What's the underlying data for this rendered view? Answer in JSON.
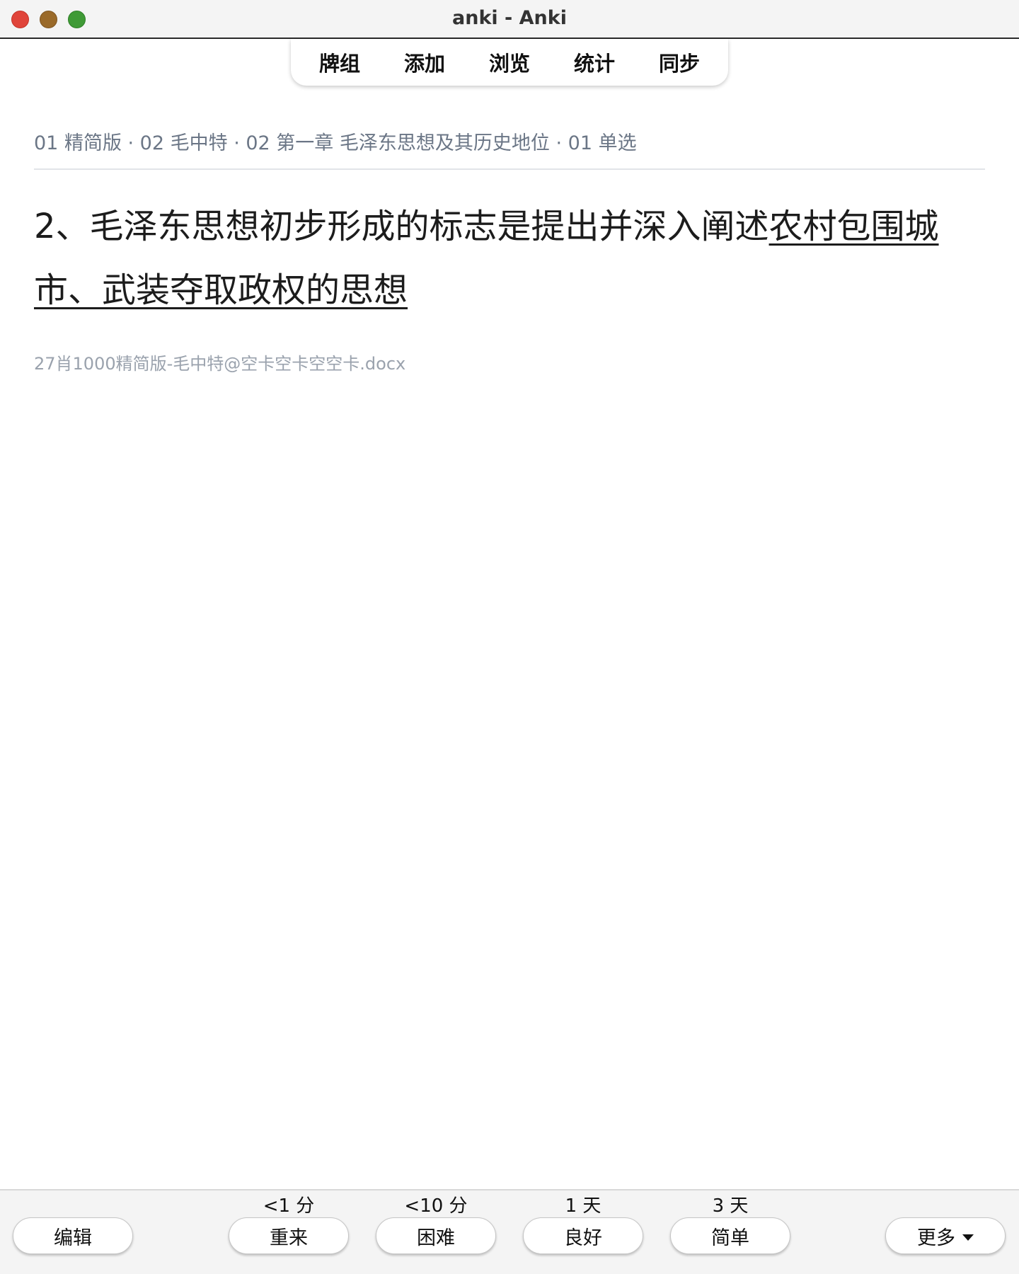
{
  "window": {
    "title": "anki - Anki"
  },
  "toolbar": {
    "items": [
      {
        "label": "牌组"
      },
      {
        "label": "添加"
      },
      {
        "label": "浏览"
      },
      {
        "label": "统计"
      },
      {
        "label": "同步"
      }
    ]
  },
  "card": {
    "deck_path": "01 精简版 · 02 毛中特 · 02 第一章 毛泽东思想及其历史地位 · 01 单选",
    "question_plain": "2、毛泽东思想初步形成的标志是提出并深入阐述",
    "question_underlined": "农村包围城市、武装夺取政权的思想",
    "source": "27肖1000精简版-毛中特@空卡空卡空空卡.docx"
  },
  "answer_bar": {
    "edit_label": "编辑",
    "more_label": "更多",
    "buttons": [
      {
        "label": "重来",
        "interval": "<1 分"
      },
      {
        "label": "困难",
        "interval": "<10 分"
      },
      {
        "label": "良好",
        "interval": "1 天"
      },
      {
        "label": "简单",
        "interval": "3 天"
      }
    ]
  },
  "icons": {
    "close": "close-traffic-light-icon",
    "minimize": "minimize-traffic-light-icon",
    "maximize": "maximize-traffic-light-icon",
    "more_caret": "caret-down-icon"
  }
}
